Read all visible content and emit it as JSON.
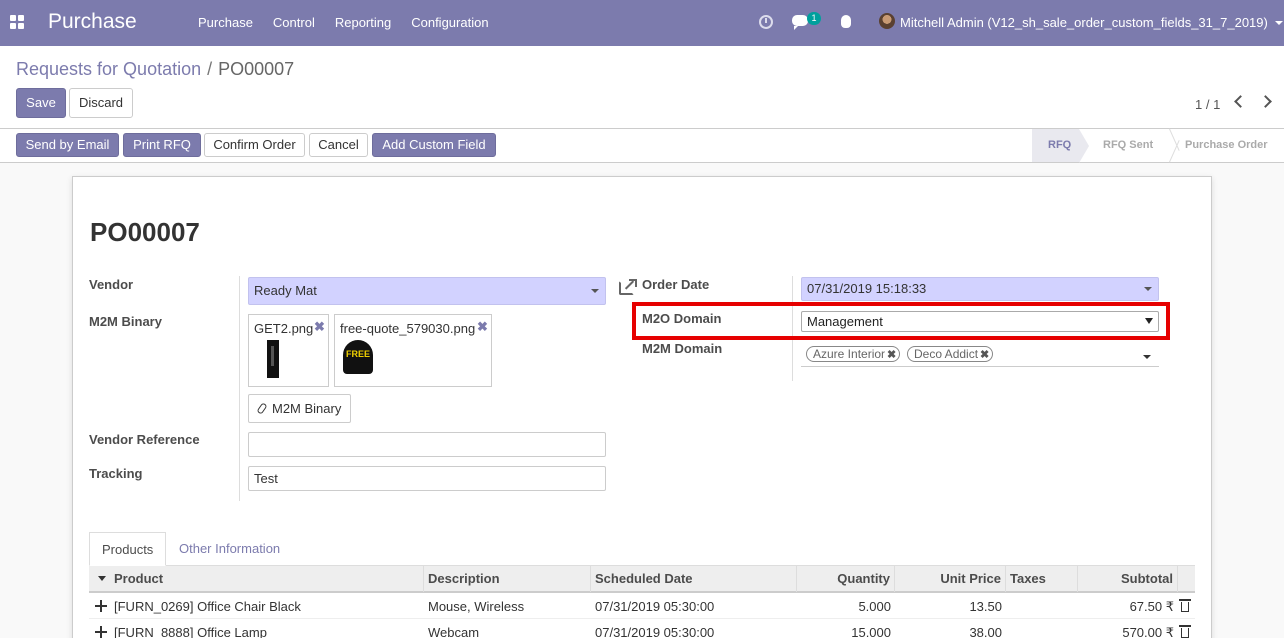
{
  "topbar": {
    "app_name": "Purchase",
    "menu": [
      "Purchase",
      "Control",
      "Reporting",
      "Configuration"
    ],
    "chat_badge": "1",
    "user": "Mitchell Admin (V12_sh_sale_order_custom_fields_31_7_2019)"
  },
  "breadcrumb": {
    "parent": "Requests for Quotation",
    "separator": "/",
    "current": "PO00007"
  },
  "actions": {
    "save": "Save",
    "discard": "Discard"
  },
  "pager": {
    "value": "1 / 1"
  },
  "header_buttons": [
    "Send by Email",
    "Print RFQ",
    "Confirm Order",
    "Cancel",
    "Add Custom Field"
  ],
  "stages": [
    "RFQ",
    "RFQ Sent",
    "Purchase Order"
  ],
  "active_stage": "RFQ",
  "form": {
    "title": "PO00007",
    "vendor_label": "Vendor",
    "vendor_value": "Ready Mat",
    "m2m_binary_label": "M2M Binary",
    "files": [
      "GET2.png",
      "free-quote_579030.png"
    ],
    "free_thumb_text": "FREE",
    "attach_button": "M2M Binary",
    "vendor_ref_label": "Vendor Reference",
    "vendor_ref_value": "",
    "tracking_label": "Tracking",
    "tracking_value": "Test",
    "order_date_label": "Order Date",
    "order_date_value": "07/31/2019 15:18:33",
    "m2o_domain_label": "M2O Domain",
    "m2o_domain_value": "Management",
    "m2m_domain_label": "M2M Domain",
    "m2m_domain_tags": [
      "Azure Interior",
      "Deco Addict"
    ]
  },
  "tabs": [
    "Products",
    "Other Information"
  ],
  "table": {
    "columns": [
      "Product",
      "Description",
      "Scheduled Date",
      "Quantity",
      "Unit Price",
      "Taxes",
      "Subtotal"
    ],
    "rows": [
      {
        "product": "[FURN_0269] Office Chair Black",
        "description": "Mouse, Wireless",
        "date": "07/31/2019 05:30:00",
        "qty": "5.000",
        "price": "13.50",
        "taxes": "",
        "subtotal": "67.50 ₹"
      },
      {
        "product": "[FURN_8888] Office Lamp",
        "description": "Webcam",
        "date": "07/31/2019 05:30:00",
        "qty": "15.000",
        "price": "38.00",
        "taxes": "",
        "subtotal": "570.00 ₹"
      }
    ]
  },
  "colors": {
    "brand": "#7c7bad",
    "highlight": "#e60000",
    "required_bg": "#d2d2ff"
  }
}
